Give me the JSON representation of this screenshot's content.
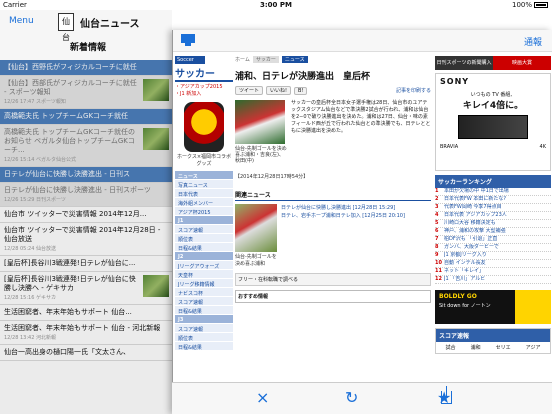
{
  "status": {
    "carrier": "Carrier",
    "time": "3:00 PM",
    "battery": "100%"
  },
  "header": {
    "menu": "Menu",
    "logo": "仙台",
    "title": "仙台ニュース",
    "subtitle": "新着情報"
  },
  "news": [
    {
      "title": "【仙台】西野氏がフィジカルコーチに就任",
      "meta": "",
      "style": "bar"
    },
    {
      "title": "【仙台】西部氏がフィジカルコーチに就任 - スポーツ報知",
      "meta": "12/26 17:47 スポーツ報知",
      "style": "grey",
      "thumb": true
    },
    {
      "title": "高橋範夫氏 トップチームGKコーチ就任",
      "meta": "",
      "style": "bar"
    },
    {
      "title": "高橋範夫氏 トップチームGKコーチ就任のお知らせ ベガルタ仙台トップチームGKコーチ...",
      "meta": "12/26 15:14 ベガルタ仙台公式",
      "style": "grey",
      "thumb": true
    },
    {
      "title": "日テレが仙台に快勝し決勝進出 - 日刊ス",
      "meta": "",
      "style": "bar"
    },
    {
      "title": "日テレが仙台に快勝し決勝進出 - 日刊スポーツ",
      "meta": "12/26 15:29 日刊スポーツ",
      "style": "grey"
    },
    {
      "title": "仙台市 ツイッターで災害情報 2014年12月...",
      "meta": "",
      "style": "plain"
    },
    {
      "title": "仙台市 ツイッターで災害情報 2014年12月28日 - 仙台放送",
      "meta": "12/28 05:24 仙台放送",
      "style": "plain"
    },
    {
      "title": "[皇后杯]長谷川3戦連発!日テレが仙台に...",
      "meta": "",
      "style": "plain"
    },
    {
      "title": "[皇后杯]長谷川3戦連発!日テレが仙台に快勝し決勝へ - ゲキサカ",
      "meta": "12/28 15:16 ゲキサカ",
      "style": "plain",
      "thumb": true
    },
    {
      "title": "生活困窮者、年末年始もサポート 仙台...",
      "meta": "",
      "style": "plain"
    },
    {
      "title": "生活困窮者、年末年始もサポート 仙台 - 河北新報",
      "meta": "12/28 13:42 河北新報",
      "style": "plain"
    },
    {
      "title": "仙台一高出身の樋口陽一氏「文太さん、",
      "meta": "",
      "style": "plain"
    }
  ],
  "panel": {
    "close_label": "通報"
  },
  "site": {
    "tag": "Soccer",
    "section": "サッカー",
    "subnav": "・アジアカップ2015\n・J1 新加入",
    "ad_caption": "ホークス×福岡市コラボグッズ",
    "nav": [
      "ニュース",
      "写真ニュース",
      "日本代表",
      "海外組メンバー",
      "アジア杯2015",
      "J1",
      "スコア速報",
      "順位表",
      "日程&結果",
      "J2",
      "Jリーグアウォーズ",
      "天皇杯",
      "Jリーグ移籍情報",
      "ナビスコ杯",
      "スコア速報",
      "日程&結果",
      "J3",
      "スコア速報",
      "順位表",
      "日程&結果"
    ],
    "nav_sections": [
      0,
      5,
      9,
      16
    ],
    "crumb": [
      "ホーム",
      "サッカー",
      "ニュース"
    ],
    "article_title": "浦和、日テレが決勝進出　皇后杯",
    "share": [
      "ツイート",
      "いいね!",
      "B!"
    ],
    "share_right": "記事を印刷する",
    "photo_caption": "仙台-先制ゴールを決め喜ぶ浦和・吉良(左)、秋田(中)",
    "body": "サッカーの皇后杯全日本女子選手権は28日、仙台市のユアテックスタジアム仙台などで準決勝2試合が行われ、浦和は仙台を2−0で破り決勝進出を決めた。浦和は27日、仙台・味の素フィールド西が丘で行われた仙台との準決勝でも、日テレとともに決勝進出を決めた。",
    "date": "【2014年12月28日17時54分】",
    "related_head": "関連ニュース",
    "related_links": [
      "日テレが仙台に快勝し決勝進出 [12月28日 15:29]",
      "日テレ、岩手ホープ浦和日テレ加入 [12月25日 20:10]"
    ],
    "related_caption": "仙台-先制ゴールを決め喜ぶ浦和",
    "job": "フリー・在科転職で調べる",
    "recommend": "おすすめ情報",
    "shop": [
      "日刊スポーツの新聞購入",
      "映画大賞"
    ],
    "sony": {
      "logo": "SONY",
      "tag": "いつもの TV 番組、",
      "big": "キレイ4倍に。",
      "foot_l": "BRAVIA",
      "foot_r": "4K"
    },
    "rank_head": "サッカーランキング",
    "ranks": [
      "本田が欠場の中 中1日で出場",
      "日本代表FW 本田に新たな?",
      "代表FW岡崎 今季7得点目",
      "日本代表 アジアカップ23人",
      "川崎ロ大谷 移籍決定も",
      "神戸、浦和の攻撃 大型補強",
      "柏DF沢も 「引退」正直",
      "ガンバ、大阪ダービーで",
      "J1 京都Jリーグ入り",
      "自動 インテル長友",
      "ネット「キレイ」",
      "J1 「吉川」アルビ"
    ],
    "boldly": {
      "t1": "BOLDLY GO",
      "t2": "Sit down for ノートン"
    },
    "score": {
      "head": "スコア速報",
      "cols": [
        "試合",
        "浦和",
        "セリエ",
        "アジア"
      ]
    }
  },
  "toolbar": {
    "close": "×",
    "refresh": "↻",
    "star": "★"
  }
}
